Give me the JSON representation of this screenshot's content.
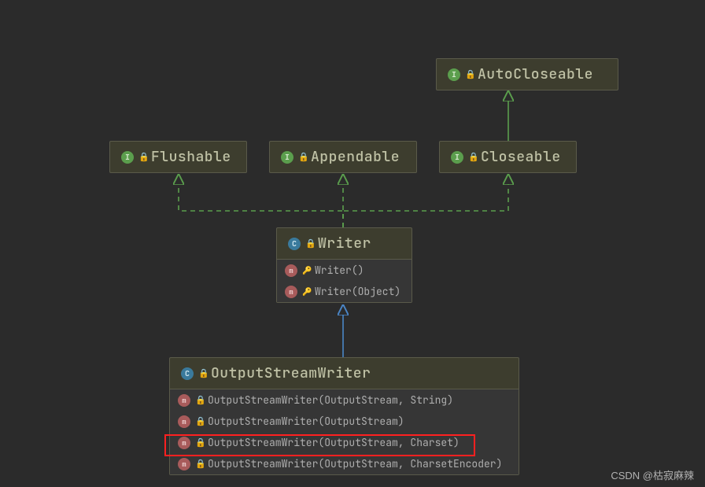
{
  "nodes": {
    "autoCloseable": {
      "name": "AutoCloseable",
      "kind": "interface"
    },
    "flushable": {
      "name": "Flushable",
      "kind": "interface"
    },
    "appendable": {
      "name": "Appendable",
      "kind": "interface"
    },
    "closeable": {
      "name": "Closeable",
      "kind": "interface"
    },
    "writer": {
      "name": "Writer",
      "kind": "class",
      "methods": [
        {
          "name": "Writer()",
          "visibility": "protected"
        },
        {
          "name": "Writer(Object)",
          "visibility": "protected"
        }
      ]
    },
    "outputStreamWriter": {
      "name": "OutputStreamWriter",
      "kind": "class",
      "methods": [
        {
          "name": "OutputStreamWriter(OutputStream, String)",
          "highlighted": false
        },
        {
          "name": "OutputStreamWriter(OutputStream)",
          "highlighted": false
        },
        {
          "name": "OutputStreamWriter(OutputStream, Charset)",
          "highlighted": true
        },
        {
          "name": "OutputStreamWriter(OutputStream, CharsetEncoder)",
          "highlighted": false
        }
      ]
    }
  },
  "watermark": "CSDN @枯寂麻辣"
}
